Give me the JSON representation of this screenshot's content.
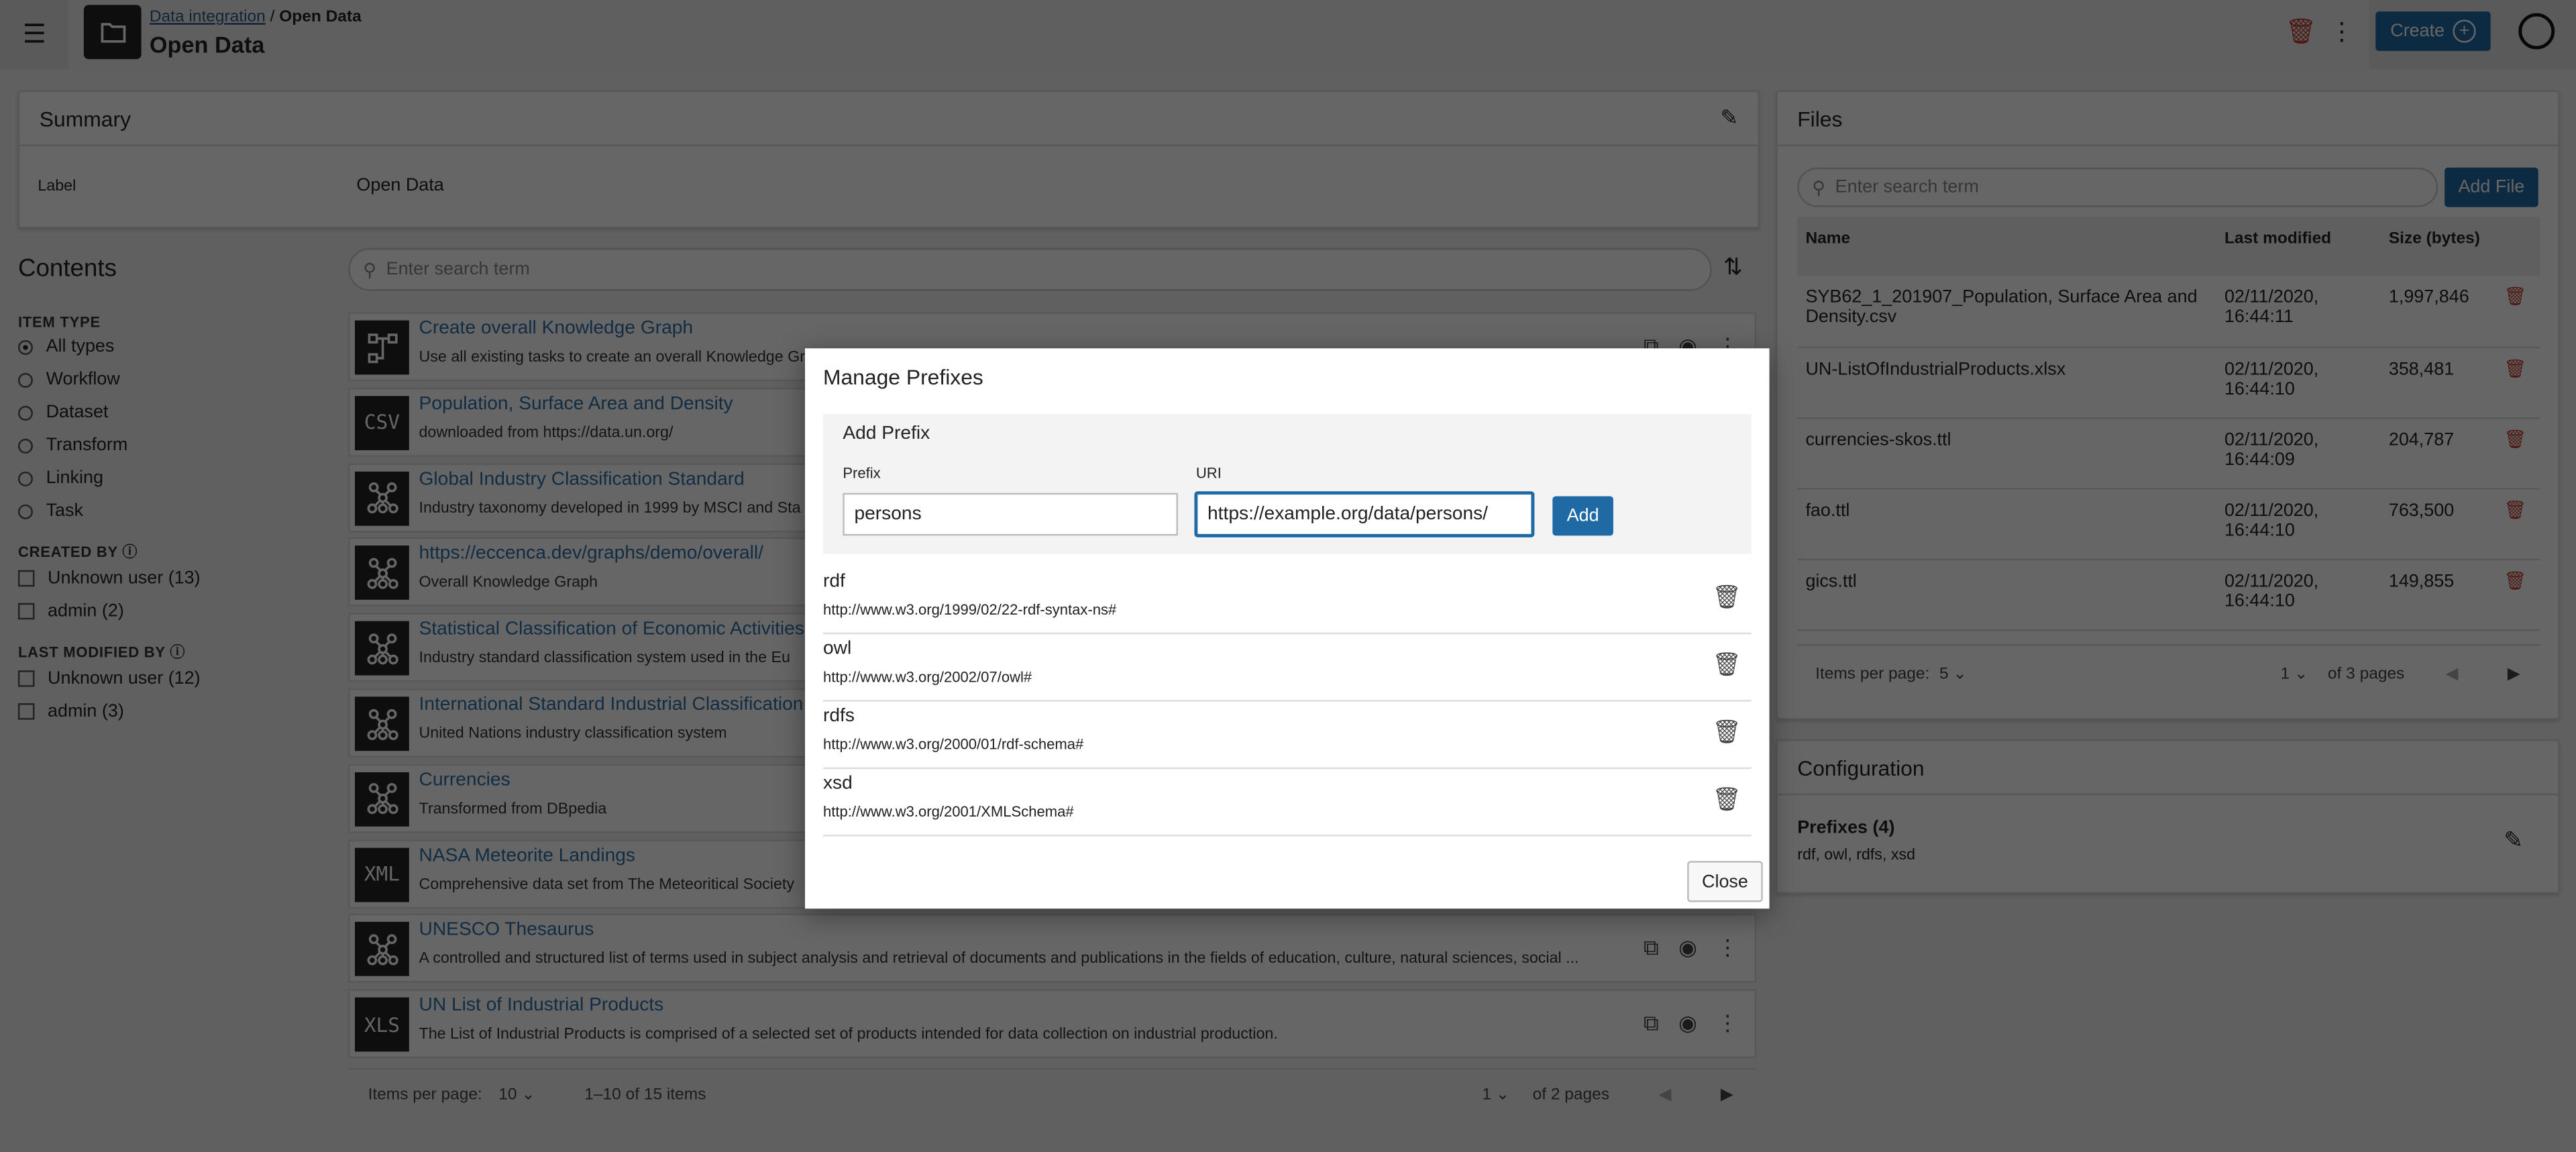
{
  "header": {
    "breadcrumb_parent": "Data integration",
    "breadcrumb_sep": "/",
    "breadcrumb_current": "Open Data",
    "title": "Open Data",
    "create_label": "Create"
  },
  "summary": {
    "title": "Summary",
    "label_key": "Label",
    "label_value": "Open Data"
  },
  "contents": {
    "title": "Contents",
    "search_placeholder": "Enter search term"
  },
  "filters": {
    "item_type": {
      "title": "ITEM TYPE",
      "options": [
        "All types",
        "Workflow",
        "Dataset",
        "Transform",
        "Linking",
        "Task"
      ],
      "selected": "All types"
    },
    "created_by": {
      "title": "CREATED BY",
      "options": [
        "Unknown user (13)",
        "admin (2)"
      ]
    },
    "last_modified_by": {
      "title": "LAST MODIFIED BY",
      "options": [
        "Unknown user (12)",
        "admin (3)"
      ]
    }
  },
  "items": [
    {
      "icon": "workflow-icon",
      "glyph": "",
      "title": "Create overall Knowledge Graph",
      "desc": "Use all existing tasks to create an overall Knowledge Graph"
    },
    {
      "icon": "csv-icon",
      "glyph": "CSV",
      "title": "Population, Surface Area and Density",
      "desc": "downloaded from https://data.un.org/"
    },
    {
      "icon": "graph-icon",
      "glyph": "",
      "title": "Global Industry Classification Standard",
      "desc": "Industry taxonomy developed in 1999 by MSCI and Sta"
    },
    {
      "icon": "graph-icon",
      "glyph": "",
      "title": "https://eccenca.dev/graphs/demo/overall/",
      "desc": "Overall Knowledge Graph"
    },
    {
      "icon": "graph-icon",
      "glyph": "",
      "title": "Statistical Classification of Economic Activities",
      "desc": "Industry standard classification system used in the Eu"
    },
    {
      "icon": "graph-icon",
      "glyph": "",
      "title": "International Standard Industrial Classification",
      "desc": "United Nations industry classification system"
    },
    {
      "icon": "graph-icon",
      "glyph": "",
      "title": "Currencies",
      "desc": "Transformed from DBpedia"
    },
    {
      "icon": "xml-icon",
      "glyph": "XML",
      "title": "NASA Meteorite Landings",
      "desc": "Comprehensive data set from The Meteoritical Society"
    },
    {
      "icon": "graph-icon",
      "glyph": "",
      "title": "UNESCO Thesaurus",
      "desc": "A controlled and structured list of terms used in subject analysis and retrieval of documents and publications in the fields of education, culture, natural sciences, social ..."
    },
    {
      "icon": "xls-icon",
      "glyph": "XLS",
      "title": "UN List of Industrial Products",
      "desc": "The List of Industrial Products is comprised of a selected set of products intended for data collection on industrial production."
    }
  ],
  "contents_pagination": {
    "items_per_page_label": "Items per page:",
    "items_per_page": "10",
    "range": "1–10 of 15 items",
    "page": "1",
    "of_pages": "of 2 pages"
  },
  "files": {
    "title": "Files",
    "search_placeholder": "Enter search term",
    "add_label": "Add File",
    "columns": [
      "Name",
      "Last modified",
      "Size (bytes)"
    ],
    "rows": [
      {
        "name": "SYB62_1_201907_Population, Surface Area and Density.csv",
        "modified": "02/11/2020, 16:44:11",
        "size": "1,997,846"
      },
      {
        "name": "UN-ListOfIndustrialProducts.xlsx",
        "modified": "02/11/2020, 16:44:10",
        "size": "358,481"
      },
      {
        "name": "currencies-skos.ttl",
        "modified": "02/11/2020, 16:44:09",
        "size": "204,787"
      },
      {
        "name": "fao.ttl",
        "modified": "02/11/2020, 16:44:10",
        "size": "763,500"
      },
      {
        "name": "gics.ttl",
        "modified": "02/11/2020, 16:44:10",
        "size": "149,855"
      }
    ],
    "pagination": {
      "items_per_page_label": "Items per page:",
      "items_per_page": "5",
      "page": "1",
      "of_pages": "of 3 pages"
    }
  },
  "configuration": {
    "title": "Configuration",
    "prefixes_title": "Prefixes (4)",
    "prefixes_list": "rdf, owl, rdfs, xsd"
  },
  "modal": {
    "title": "Manage Prefixes",
    "add_section": "Add Prefix",
    "prefix_label": "Prefix",
    "uri_label": "URI",
    "prefix_value": "persons",
    "uri_value": "https://example.org/data/persons/",
    "add_label": "Add",
    "close_label": "Close",
    "prefixes": [
      {
        "name": "rdf",
        "uri": "http://www.w3.org/1999/02/22-rdf-syntax-ns#"
      },
      {
        "name": "owl",
        "uri": "http://www.w3.org/2002/07/owl#"
      },
      {
        "name": "rdfs",
        "uri": "http://www.w3.org/2000/01/rdf-schema#"
      },
      {
        "name": "xsd",
        "uri": "http://www.w3.org/2001/XMLSchema#"
      }
    ]
  },
  "colors": {
    "accent": "#1f6aa5",
    "link": "#2a6fa8",
    "danger": "#c0392b"
  }
}
